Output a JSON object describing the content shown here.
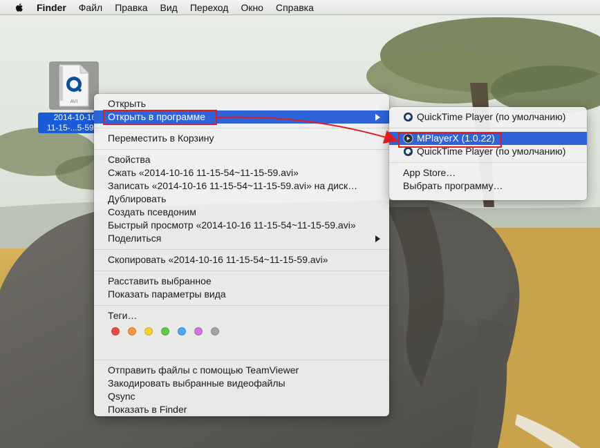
{
  "menubar": {
    "app": "Finder",
    "items": [
      "Файл",
      "Правка",
      "Вид",
      "Переход",
      "Окно",
      "Справка"
    ]
  },
  "desktop_file": {
    "type_badge": "AVI",
    "name_line1": "2014-10-16",
    "name_line2": "11-15-...5-59."
  },
  "context_menu": {
    "open": "Открыть",
    "open_with": "Открыть в программе",
    "move_to_trash": "Переместить в Корзину",
    "get_info": "Свойства",
    "compress": "Сжать «2014-10-16 11-15-54~11-15-59.avi»",
    "burn": "Записать «2014-10-16 11-15-54~11-15-59.avi» на диск…",
    "duplicate": "Дублировать",
    "make_alias": "Создать псевдоним",
    "quick_look": "Быстрый просмотр «2014-10-16 11-15-54~11-15-59.avi»",
    "share": "Поделиться",
    "copy": "Скопировать «2014-10-16 11-15-54~11-15-59.avi»",
    "clean_up": "Расставить выбранное",
    "show_view_options": "Показать параметры вида",
    "tags": "Теги…",
    "tag_colors": [
      "#ee4c45",
      "#f39a36",
      "#f5cd2f",
      "#5fcb44",
      "#4aa8f3",
      "#c97ad8",
      "#a5a5a5"
    ],
    "send_teamviewer": "Отправить файлы с помощью TeamViewer",
    "encode_video": "Закодировать выбранные видеофайлы",
    "qsync": "Qsync",
    "reveal_finder": "Показать в Finder"
  },
  "open_with_submenu": {
    "default_app": "QuickTime Player (по умолчанию)",
    "mplayerx": "MPlayerX (1.0.22)",
    "quicktime": "QuickTime Player (по умолчанию)",
    "app_store": "App Store…",
    "choose_app": "Выбрать программу…"
  },
  "colors": {
    "highlight": "#2f63d8",
    "annotation_red": "#e01b22"
  }
}
